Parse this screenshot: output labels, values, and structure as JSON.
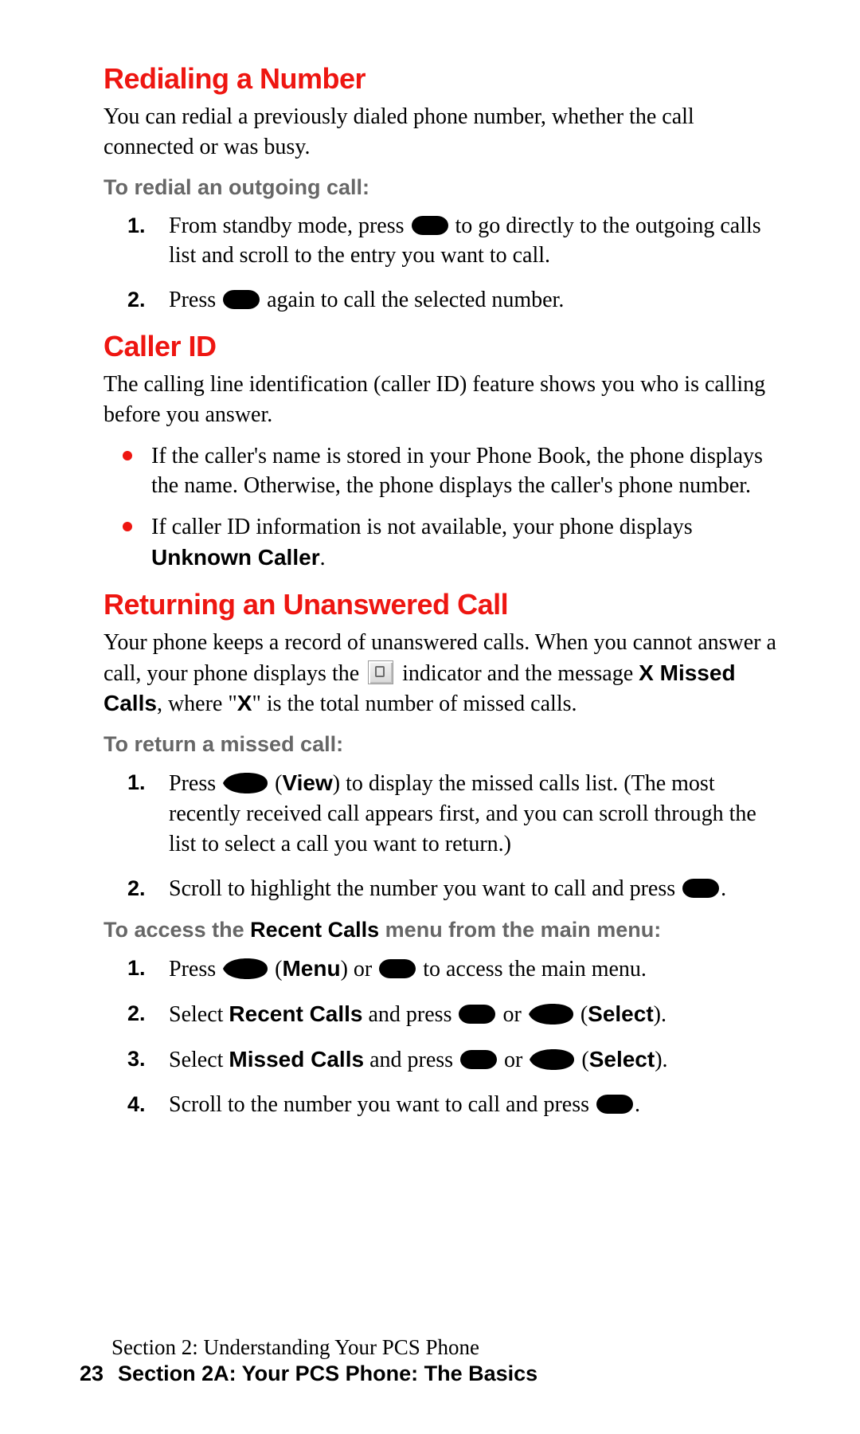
{
  "sections": {
    "redial": {
      "heading": "Redialing a Number",
      "intro": "You can redial a previously dialed phone number, whether the call connected or was busy.",
      "sub": "To redial an outgoing call:",
      "step1_a": "From standby mode, press ",
      "step1_b": " to go directly to the outgoing calls list and scroll to the entry you want to call.",
      "step2_a": "Press ",
      "step2_b": " again to call the selected number."
    },
    "callerid": {
      "heading": "Caller ID",
      "intro": "The calling line identification (caller ID) feature shows you who is calling before you answer.",
      "bullet1": "If the caller's name is stored in your Phone Book, the phone displays the name. Otherwise, the phone displays the caller's phone number.",
      "bullet2_a": "If caller ID information is not available, your phone displays ",
      "bullet2_b": "Unknown Caller",
      "bullet2_c": "."
    },
    "return": {
      "heading": "Returning an Unanswered Call",
      "intro_a": "Your phone keeps a record of unanswered calls. When you cannot answer a call, your phone displays the ",
      "intro_b": " indicator and the message ",
      "intro_c": "X Missed Calls",
      "intro_d": ", where \"",
      "intro_e": "X",
      "intro_f": "\" is the total number of missed calls.",
      "subA": "To return a missed call:",
      "a1_a": "Press ",
      "a1_b": " (",
      "a1_c": "View",
      "a1_d": ") to display the missed calls list. (The most recently received call appears first, and you can scroll through the list to select a call you want to return.)",
      "a2_a": "Scroll to highlight the number you want to call and press ",
      "a2_b": ".",
      "subB_a": "To access the ",
      "subB_b": "Recent Calls",
      "subB_c": " menu from the main menu:",
      "b1_a": "Press ",
      "b1_b": " (",
      "b1_c": "Menu",
      "b1_d": ") or ",
      "b1_e": " to access the main menu.",
      "b2_a": "Select ",
      "b2_b": "Recent Calls",
      "b2_c": " and press ",
      "b2_d": " or ",
      "b2_e": " (",
      "b2_f": "Select",
      "b2_g": ").",
      "b3_a": "Select ",
      "b3_b": "Missed Calls",
      "b3_c": " and press ",
      "b3_d": " or ",
      "b3_e": " (",
      "b3_f": "Select",
      "b3_g": ").",
      "b4_a": "Scroll to the number you want to call and press ",
      "b4_b": "."
    }
  },
  "footer": {
    "line1": "Section 2: Understanding Your PCS Phone",
    "page": "23",
    "line2": "Section 2A: Your PCS Phone: The Basics"
  }
}
